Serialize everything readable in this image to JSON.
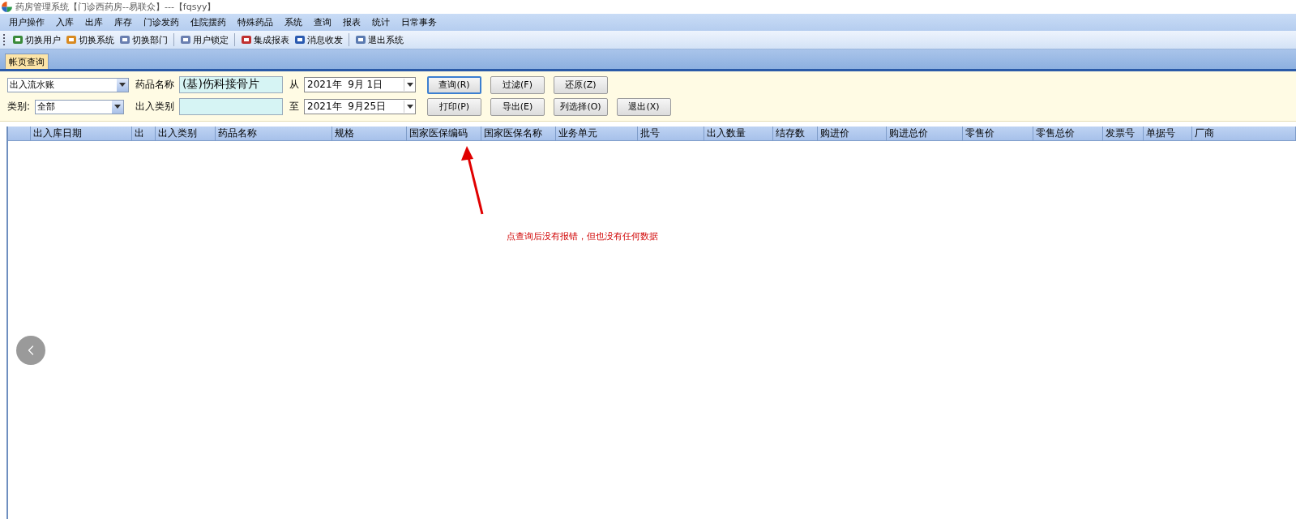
{
  "window": {
    "title": "药房管理系统【门诊西药房--易联众】---【fqsyy】"
  },
  "menu": [
    "用户操作",
    "入库",
    "出库",
    "库存",
    "门诊发药",
    "住院摆药",
    "特殊药品",
    "系统",
    "查询",
    "报表",
    "统计",
    "日常事务"
  ],
  "toolbar": [
    [
      "切换用户",
      "切换系统",
      "切换部门"
    ],
    [
      "用户锁定"
    ],
    [
      "集成报表",
      "消息收发"
    ],
    [
      "退出系统"
    ]
  ],
  "tabs": [
    {
      "label": "帐页查询",
      "selected": true
    }
  ],
  "filters": {
    "ledger_type": {
      "value": "出入流水账"
    },
    "category_label": "类别:",
    "category": {
      "value": "全部"
    },
    "drug_label": "药品名称",
    "drug": {
      "value": "(基)伤科接骨片"
    },
    "io_type_label": "出入类别",
    "from_label": "从",
    "from_date": {
      "value": "2021年  9月 1日"
    },
    "to_label": "至",
    "to_date": {
      "value": "2021年  9月25日"
    }
  },
  "buttons": [
    [
      "查询(R)",
      "过滤(F)",
      "还原(Z)"
    ],
    [
      "打印(P)",
      "导出(E)",
      "列选择(O)",
      "退出(X)"
    ]
  ],
  "table": {
    "columns": [
      "出入库日期",
      "出",
      "出入类别",
      "药品名称",
      "规格",
      "国家医保编码",
      "国家医保名称",
      "业务单元",
      "批号",
      "出入数量",
      "结存数",
      "购进价",
      "购进总价",
      "零售价",
      "零售总价",
      "发票号",
      "单据号",
      "厂商"
    ]
  },
  "annotation": {
    "text": "点查询后没有报错，但也没有任何数据"
  }
}
